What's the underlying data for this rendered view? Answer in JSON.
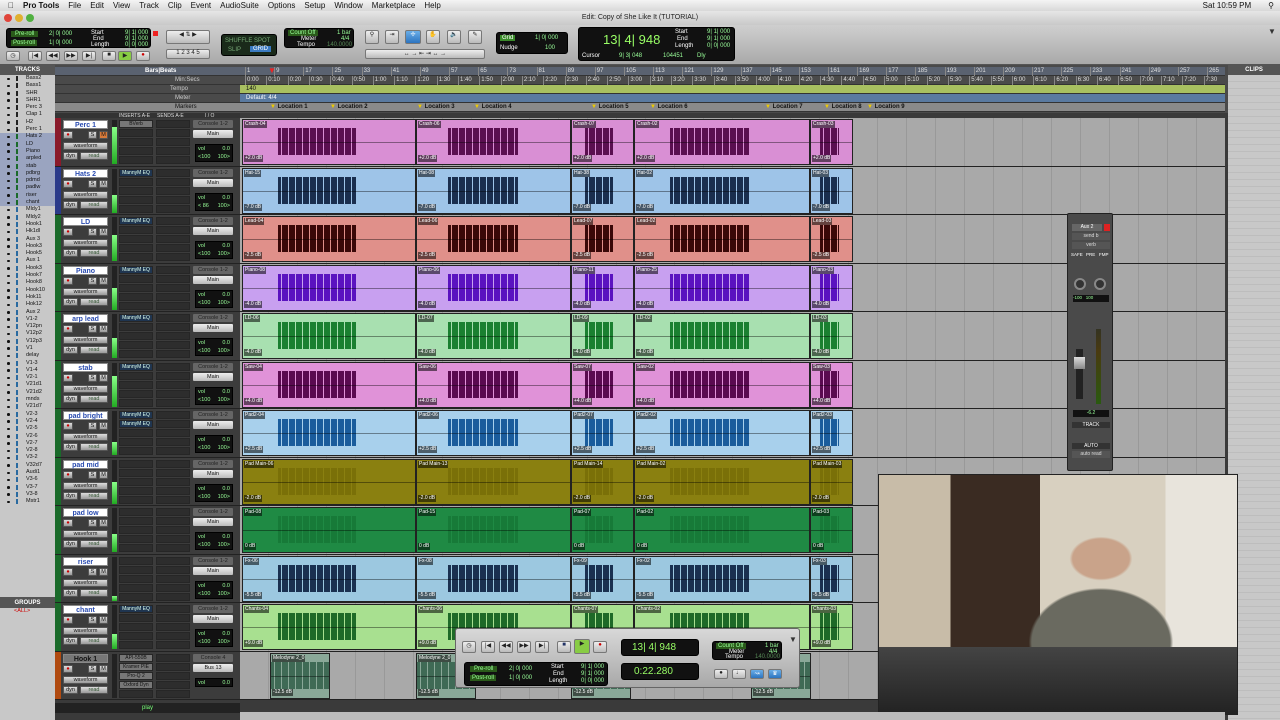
{
  "menubar": {
    "apple": "",
    "app": "Pro Tools",
    "items": [
      "File",
      "Edit",
      "View",
      "Track",
      "Clip",
      "Event",
      "AudioSuite",
      "Options",
      "Setup",
      "Window",
      "Marketplace",
      "Help"
    ],
    "clock": "Sat 10:59 PM"
  },
  "window": {
    "title": "Edit: Copy of She Like It (TUTORIAL)"
  },
  "toolbar": {
    "preroll_label": "Pre-roll",
    "preroll": "2| 0| 000",
    "postroll_label": "Post-roll",
    "postroll": "1| 0| 000",
    "start_label": "Start",
    "start": "9| 1| 000",
    "end_label": "End",
    "end": "9| 1| 000",
    "length_label": "Length",
    "length": "0| 0| 000",
    "modes": [
      "SHUFFLE",
      "SPOT",
      "SLIP",
      "GRID"
    ],
    "countoff": "Count Off",
    "countoff_val": "1 bar",
    "meter_label": "Meter",
    "meter_val": "4/4",
    "tempo_label": "Tempo",
    "tempo_val": "140.0000",
    "zoom_presets": [
      "1",
      "2",
      "3",
      "4",
      "5"
    ],
    "grid_label": "Grid",
    "grid_val": "1| 0| 000",
    "nudge_label": "Nudge",
    "nudge_val": "100",
    "main_counter": "13| 4| 948",
    "cursor_label": "Cursor",
    "cursor_val": "9| 3| 048",
    "sample_val": "104451",
    "dly": "Dly"
  },
  "rulers": {
    "bars_label": "Bars|Beats",
    "min_label": "Min:Secs",
    "tempo_label": "Tempo",
    "tempo_val": "140",
    "meter_label": "Meter",
    "meter_val": "Default: 4/4",
    "markers_label": "Markers",
    "bars": [
      "1",
      "9",
      "17",
      "25",
      "33",
      "41",
      "49",
      "57",
      "65",
      "73",
      "81",
      "89",
      "97",
      "105",
      "113",
      "121",
      "129",
      "137",
      "145",
      "153",
      "161",
      "169",
      "177",
      "185",
      "193",
      "201",
      "209",
      "217",
      "225",
      "233",
      "241",
      "249",
      "257",
      "265"
    ],
    "times": [
      "0:00",
      "0:10",
      "0:20",
      "0:30",
      "0:40",
      "0:50",
      "1:00",
      "1:10",
      "1:20",
      "1:30",
      "1:40",
      "1:50",
      "2:00",
      "2:10",
      "2:20",
      "2:30",
      "2:40",
      "2:50",
      "3:00",
      "3:10",
      "3:20",
      "3:30",
      "3:40",
      "3:50",
      "4:00",
      "4:10",
      "4:20",
      "4:30",
      "4:40",
      "4:50",
      "5:00",
      "5:10",
      "5:20",
      "5:30",
      "5:40",
      "5:50",
      "6:00",
      "6:10",
      "6:20",
      "6:30",
      "6:40",
      "6:50",
      "7:00",
      "7:10",
      "7:20",
      "7:30"
    ],
    "markers": [
      "Location 1",
      "Location 2",
      "Location 3",
      "Location 4",
      "Location 5",
      "Location 6",
      "Location 7",
      "Location 8",
      "Location 9"
    ]
  },
  "columns": {
    "inserts": "INSERTS A-E",
    "sends": "SENDS A-E",
    "io": "I / O"
  },
  "tracklist": {
    "title": "TRACKS",
    "items": [
      "Bass2",
      "Bass1",
      "SHR",
      "SHR1",
      "Perc 3",
      "Clap 1",
      "H2",
      "Perc 1",
      "Hats 2",
      "LD",
      "Piano",
      "arpled",
      "stab",
      "pdbrg",
      "pdmd",
      "padlw",
      "riser",
      "chant",
      "Mldy1",
      "Mldy2",
      "Hook1",
      "Hk1dl",
      "Aux 3",
      "Hook3",
      "Hook5",
      "Aux 1",
      "Hook3",
      "Hook7",
      "Hook8",
      "Hook10",
      "Hok11",
      "Hok12",
      "Aux 2",
      "V1-2",
      "V12pn",
      "V12p2",
      "V12p3",
      "V1",
      "delay",
      "V1-3",
      "V1-4",
      "V2-1",
      "V21d1",
      "V21d2",
      "mnds",
      "V21d7",
      "V2-3",
      "V2-4",
      "V2-5",
      "V2-6",
      "V2-7",
      "V2-8",
      "V3-2",
      "V32d7",
      "Audi1",
      "V3-6",
      "V3-7",
      "V3-8",
      "Mstr1"
    ]
  },
  "groups": {
    "title": "GROUPS",
    "all": "<ALL>"
  },
  "clips": {
    "title": "CLIPS"
  },
  "tracks": [
    {
      "name": "Perc 1",
      "color": "#8a1a2a",
      "light": "#d98fd4",
      "dark": "#5a0f50",
      "inserts": [
        "BVerb"
      ],
      "io_in": "Console 1-2",
      "io_out": "Main",
      "vol": "0.0",
      "pan_l": "<100",
      "pan_r": "100>",
      "view": "waveform",
      "dyn": "dyn",
      "auto": "read",
      "clips": [
        "Crash-04",
        "Crash-06",
        "Crash-07",
        "Crash-02",
        "Crash-03"
      ],
      "gain": "+2.0 dB",
      "meter": 0.85
    },
    {
      "name": "Hats 2",
      "color": "#2a3a8a",
      "light": "#9ec4e8",
      "dark": "#1a2e4e",
      "inserts": [
        "MannyM EQ"
      ],
      "io_in": "Console 1-2",
      "io_out": "Main",
      "vol": "0.0",
      "pan_l": "< 86",
      "pan_r": "100>",
      "view": "waveform",
      "dyn": "dyn",
      "auto": "read",
      "clips": [
        "Hat-15",
        "Hat-08",
        "Hat-38",
        "Hat-02",
        "Hat-03"
      ],
      "gain": "-7.0 dB",
      "meter": 0.4
    },
    {
      "name": "LD",
      "color": "#1a6a2a",
      "light": "#e0908a",
      "dark": "#3a0808",
      "inserts": [
        "MannyM EQ"
      ],
      "io_in": "Console 1-2",
      "io_out": "Main",
      "vol": "0.0",
      "pan_l": "<100",
      "pan_r": "100>",
      "view": "waveform",
      "dyn": "dyn",
      "auto": "read",
      "clips": [
        "Lead-04",
        "Lead-06",
        "Lead-07",
        "Lead-02",
        "Lead-03"
      ],
      "gain": "-2.5 dB",
      "meter": 0.6
    },
    {
      "name": "Piano",
      "color": "#1a6a2a",
      "light": "#c8a0f0",
      "dark": "#5a12c0",
      "inserts": [
        "MannyM EQ"
      ],
      "io_in": "Console 1-2",
      "io_out": "Main",
      "vol": "0.0",
      "pan_l": "<100",
      "pan_r": "100>",
      "view": "waveform",
      "dyn": "dyn",
      "auto": "read",
      "clips": [
        "Piano-08",
        "Piano-06",
        "Piano-11",
        "Piano-25",
        "Piano-03"
      ],
      "gain": "-4.0 dB",
      "meter": 0.5
    },
    {
      "name": "arp lead",
      "color": "#1a6a2a",
      "light": "#a8e0b0",
      "dark": "#1a8030",
      "inserts": [
        "MannyM EQ"
      ],
      "io_in": "Console 1-2",
      "io_out": "Main",
      "vol": "0.0",
      "pan_l": "<100",
      "pan_r": "100>",
      "view": "waveform",
      "dyn": "dyn",
      "auto": "read",
      "clips": [
        "LD-06",
        "LD-07",
        "LD-09",
        "LD-02",
        "LD-03"
      ],
      "gain": "-4.0 dB",
      "meter": 0.45
    },
    {
      "name": "stab",
      "color": "#1a6a2a",
      "light": "#e092d8",
      "dark": "#5a0a50",
      "inserts": [
        "MannyM EQ"
      ],
      "io_in": "Console 1-2",
      "io_out": "Main",
      "vol": "0.0",
      "pan_l": "<100",
      "pan_r": "100>",
      "view": "waveform",
      "dyn": "dyn",
      "auto": "read",
      "clips": [
        "Saw-04",
        "Saw-06",
        "Saw-07",
        "Saw-02",
        "Saw-03"
      ],
      "gain": "+4.0 dB",
      "meter": 0.7
    },
    {
      "name": "pad bright",
      "color": "#1a6a2a",
      "light": "#a8d0ec",
      "dark": "#1a5c9c",
      "inserts": [
        "MannyM EQ",
        "MannyM EQ"
      ],
      "io_in": "Console 1-2",
      "io_out": "Main",
      "vol": "0.0",
      "pan_l": "<100",
      "pan_r": "100>",
      "view": "waveform",
      "dyn": "dyn",
      "auto": "read",
      "clips": [
        "Pad2-04",
        "Pad2-06",
        "Pad2-07",
        "Pad2-02",
        "Pad2-03"
      ],
      "gain": "+2.5 dB",
      "meter": 0.3
    },
    {
      "name": "pad mid",
      "color": "#1a6a2a",
      "light": "#8a8010",
      "dark": "#7a7008",
      "inserts": [],
      "io_in": "Console 1-2",
      "io_out": "Main",
      "vol": "0.0",
      "pan_l": "<100",
      "pan_r": "100>",
      "view": "waveform",
      "dyn": "dyn",
      "auto": "read",
      "clips": [
        "Pad Main-06",
        "Pad Main-13",
        "Pad Main-14",
        "Pad Main-02",
        "Pad Main-03"
      ],
      "gain": "-2.0 dB",
      "meter": 0.5
    },
    {
      "name": "pad low",
      "color": "#1a6a2a",
      "light": "#1f8a44",
      "dark": "#177a38",
      "inserts": [],
      "io_in": "Console 1-2",
      "io_out": "Main",
      "vol": "0.0",
      "pan_l": "<100",
      "pan_r": "100>",
      "view": "waveform",
      "dyn": "dyn",
      "auto": "read",
      "clips": [
        "Pad-08",
        "Pad-15",
        "Pad-07",
        "Pad-02",
        "Pad-03"
      ],
      "gain": "0 dB",
      "meter": 0.4
    },
    {
      "name": "riser",
      "color": "#1a6a2a",
      "light": "#9cc8e0",
      "dark": "#1a3050",
      "inserts": [],
      "io_in": "Console 1-2",
      "io_out": "Main",
      "vol": "0.0",
      "pan_l": "<100",
      "pan_r": "100>",
      "view": "waveform",
      "dyn": "dyn",
      "auto": "read",
      "clips": [
        "Fx-06",
        "Fx-08",
        "Fx-09",
        "Fx-02",
        "Fx-03"
      ],
      "gain": "-5.5 dB",
      "meter": 0.1
    },
    {
      "name": "chant",
      "color": "#1a6a2a",
      "light": "#a8e090",
      "dark": "#1e6a28",
      "inserts": [
        "MannyM EQ"
      ],
      "io_in": "Console 1-2",
      "io_out": "Main",
      "vol": "0.0",
      "pan_l": "<100",
      "pan_r": "100>",
      "view": "waveform",
      "dyn": "dyn",
      "auto": "read",
      "clips": [
        "Chants-04",
        "Chants-06",
        "Chants-07",
        "Chants-02",
        "Chants-03"
      ],
      "gain": "+9.0 dB",
      "meter": 0.35
    },
    {
      "name": "Hook 1",
      "color": "#b04a10",
      "light": "#8aa898",
      "dark": "#3f6a55",
      "inserts": [
        "API-550B",
        "Kramer PIE",
        "Pro-Q 2",
        "Oxford Dyn"
      ],
      "io_in": "Console 4",
      "io_out": "Bus 13",
      "vol": "0.0",
      "pan_l": "",
      "pan_r": "",
      "view": "waveform",
      "dyn": "dyn",
      "auto": "read",
      "clips": [
        "Melodyne 2_0",
        "Melodyne 2_0",
        "Melodyne 2_0",
        "Melodyne 2_0"
      ],
      "gain": "-12.5 dB",
      "meter": 0.0,
      "hook": true
    }
  ],
  "mixer": {
    "name": "Aux 2",
    "send": "send b",
    "insert": "verb",
    "safe": "SAFE",
    "pre": "PRE",
    "fmp": "FMP",
    "pan_l": "-100",
    "pan_r": "100",
    "level": "-6.2",
    "track": "TRACK",
    "auto": "AUTO",
    "auto_mode": "auto read"
  },
  "transport": {
    "counter": "13| 4| 948",
    "sub_counter": "0:22.280",
    "preroll_label": "Pre-roll",
    "preroll": "2| 0| 000",
    "postroll_label": "Post-roll",
    "postroll": "1| 0| 000",
    "start_label": "Start",
    "start": "9| 1| 000",
    "end_label": "End",
    "end": "9| 1| 000",
    "length_label": "Length",
    "length": "0| 0| 000",
    "countoff": "Count Off",
    "countoff_val": "1 bar",
    "meter_label": "Meter",
    "meter_val": "4/4",
    "tempo_label": "Tempo",
    "tempo_val": "140.0000"
  },
  "status": {
    "play": "play"
  }
}
